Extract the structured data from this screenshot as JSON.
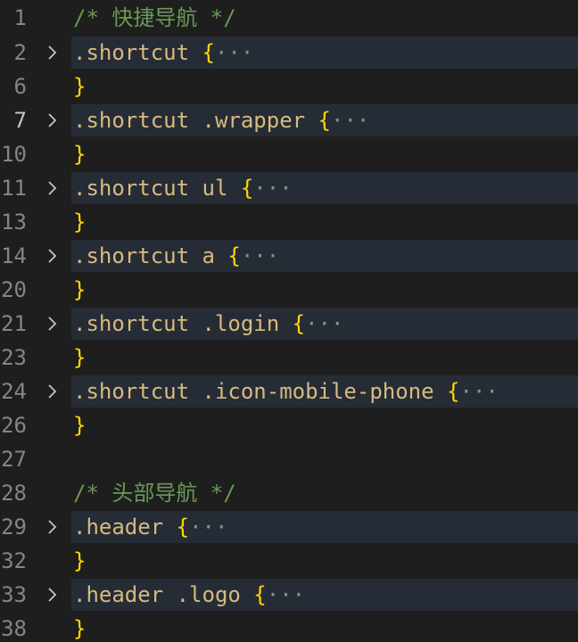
{
  "lines": [
    {
      "num": "1",
      "type": "comment",
      "text": "/* 快捷导航 */"
    },
    {
      "num": "2",
      "type": "folded",
      "selector": ".shortcut",
      "brace": "{",
      "ellipsis": "···"
    },
    {
      "num": "6",
      "type": "close",
      "brace": "}"
    },
    {
      "num": "7",
      "type": "folded",
      "selector": ".shortcut .wrapper",
      "brace": "{",
      "ellipsis": "···",
      "active": true
    },
    {
      "num": "10",
      "type": "close",
      "brace": "}"
    },
    {
      "num": "11",
      "type": "folded",
      "selector": ".shortcut ul",
      "brace": "{",
      "ellipsis": "···"
    },
    {
      "num": "13",
      "type": "close",
      "brace": "}"
    },
    {
      "num": "14",
      "type": "folded",
      "selector": ".shortcut a",
      "brace": "{",
      "ellipsis": "···"
    },
    {
      "num": "20",
      "type": "close",
      "brace": "}"
    },
    {
      "num": "21",
      "type": "folded",
      "selector": ".shortcut .login",
      "brace": "{",
      "ellipsis": "···"
    },
    {
      "num": "23",
      "type": "close",
      "brace": "}"
    },
    {
      "num": "24",
      "type": "folded",
      "selector": ".shortcut .icon-mobile-phone",
      "brace": "{",
      "ellipsis": "···"
    },
    {
      "num": "26",
      "type": "close",
      "brace": "}"
    },
    {
      "num": "27",
      "type": "blank"
    },
    {
      "num": "28",
      "type": "comment",
      "text": "/* 头部导航 */"
    },
    {
      "num": "29",
      "type": "folded",
      "selector": ".header",
      "brace": "{",
      "ellipsis": "···"
    },
    {
      "num": "32",
      "type": "close",
      "brace": "}"
    },
    {
      "num": "33",
      "type": "folded",
      "selector": ".header .logo",
      "brace": "{",
      "ellipsis": "···"
    },
    {
      "num": "38",
      "type": "close",
      "brace": "}"
    }
  ],
  "colors": {
    "background": "#1e1e1e",
    "folded_highlight": "#262c36",
    "comment": "#6a9955",
    "selector": "#d7ba7d",
    "brace": "#ffd700",
    "line_number": "#858585",
    "active_line_number": "#c6c6c6"
  },
  "icons": {
    "fold": "chevron-right-icon"
  }
}
